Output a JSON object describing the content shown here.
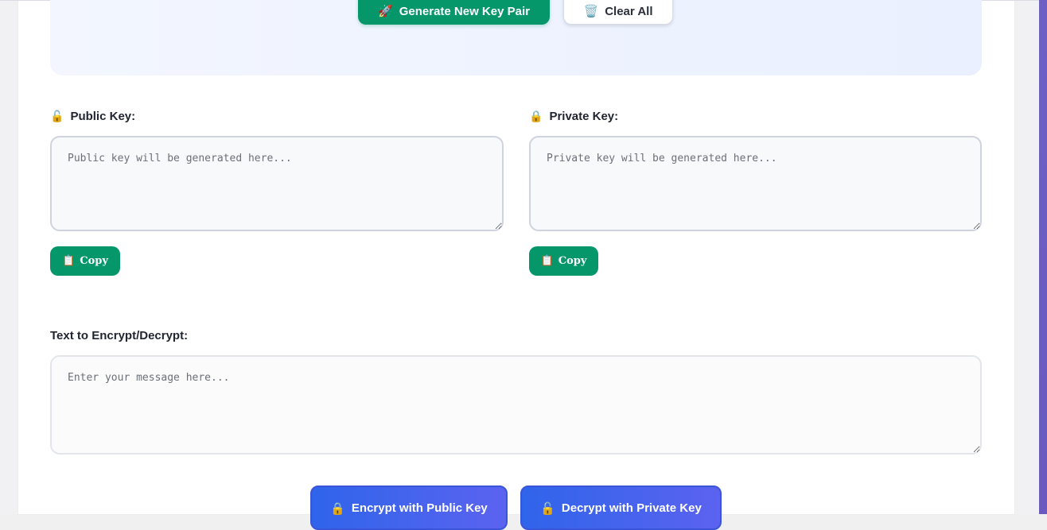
{
  "keygen": {
    "generate_label": "Generate New Key Pair",
    "generate_icon": "🚀",
    "clear_label": "Clear All",
    "clear_icon": "🗑️"
  },
  "public_key": {
    "icon": "🔓",
    "label": "Public Key:",
    "placeholder": "Public key will be generated here...",
    "value": "",
    "copy_icon": "📋",
    "copy_label": "Copy"
  },
  "private_key": {
    "icon": "🔒",
    "label": "Private Key:",
    "placeholder": "Private key will be generated here...",
    "value": "",
    "copy_icon": "📋",
    "copy_label": "Copy"
  },
  "message": {
    "label": "Text to Encrypt/Decrypt:",
    "placeholder": "Enter your message here...",
    "value": ""
  },
  "actions": {
    "encrypt_icon": "🔒",
    "encrypt_label": "Encrypt with Public Key",
    "decrypt_icon": "🔓",
    "decrypt_label": "Decrypt with Private Key"
  },
  "colors": {
    "green": "#059669",
    "blue": "#2f64ea",
    "purple_strip": "#6d5fc4"
  }
}
